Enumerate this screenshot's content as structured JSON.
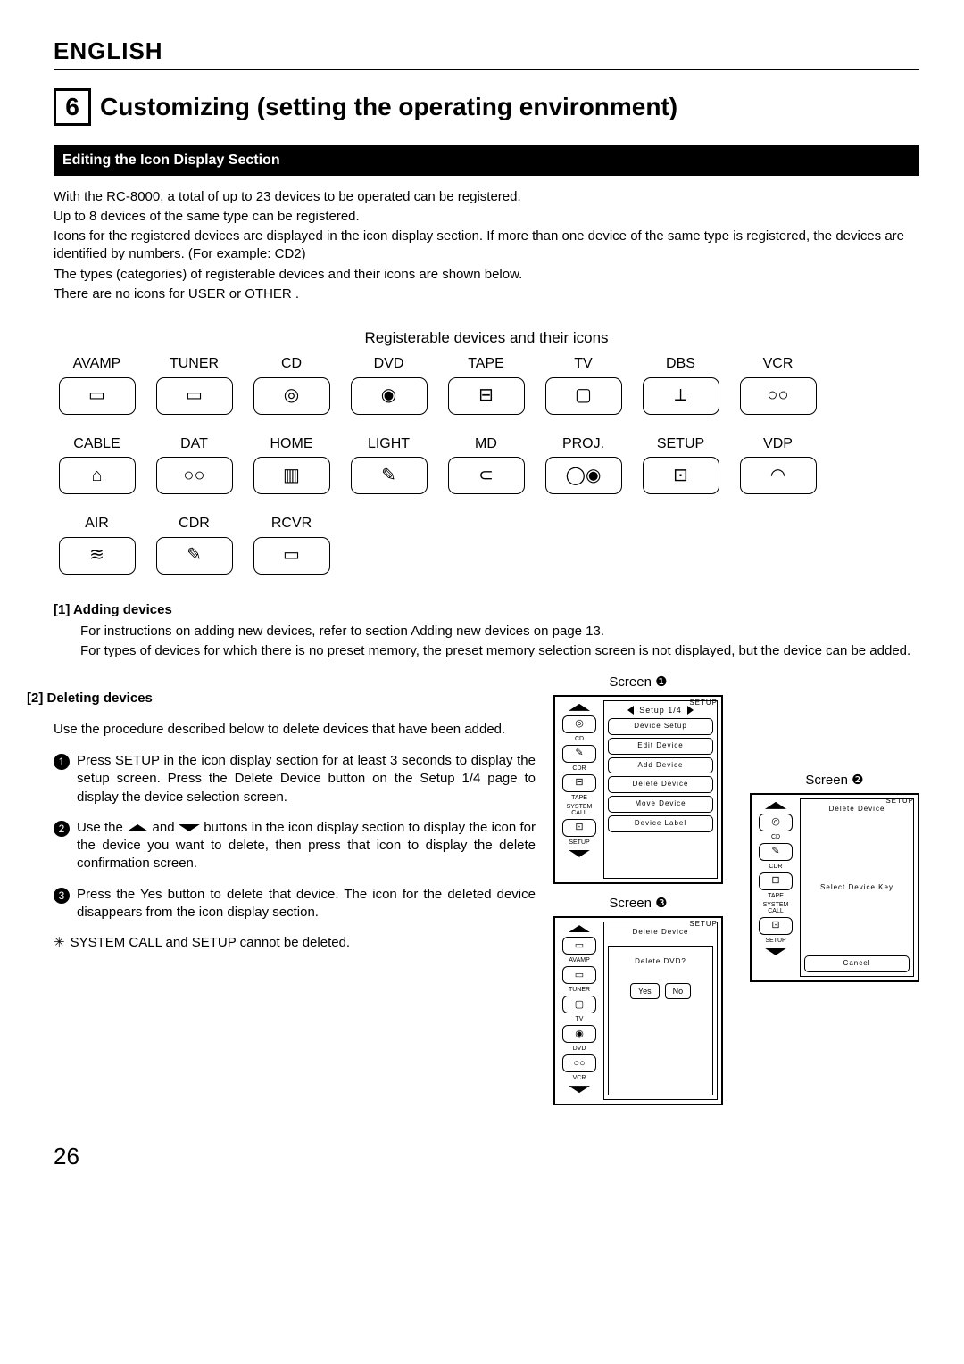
{
  "lang": "ENGLISH",
  "section_number": "6",
  "section_title": "Customizing (setting the operating environment)",
  "black_bar": "Editing the Icon Display Section",
  "intro": [
    "With the RC-8000, a total of up to 23 devices to be operated can be registered.",
    "Up to 8 devices of the same type can be registered.",
    "Icons for the registered devices are displayed in the icon display section.  If more than one device of the same type is registered, the devices are identified by numbers.  (For example:  CD2)",
    "The types (categories) of registerable devices and their icons are shown below.",
    "There are no icons for  USER  or  OTHER ."
  ],
  "icons_caption": "Registerable devices and their icons",
  "icons": [
    {
      "label": "AVAMP",
      "glyph": "▭"
    },
    {
      "label": "TUNER",
      "glyph": "▭"
    },
    {
      "label": "CD",
      "glyph": "◎"
    },
    {
      "label": "DVD",
      "glyph": "◉"
    },
    {
      "label": "TAPE",
      "glyph": "⊟"
    },
    {
      "label": "TV",
      "glyph": "▢"
    },
    {
      "label": "DBS",
      "glyph": "⟂"
    },
    {
      "label": "VCR",
      "glyph": "○○"
    },
    {
      "label": "CABLE",
      "glyph": "⌂"
    },
    {
      "label": "DAT",
      "glyph": "○○"
    },
    {
      "label": "HOME",
      "glyph": "▥"
    },
    {
      "label": "LIGHT",
      "glyph": "✎"
    },
    {
      "label": "MD",
      "glyph": "⊂"
    },
    {
      "label": "PROJ.",
      "glyph": "◯◉"
    },
    {
      "label": "SETUP",
      "glyph": "⊡"
    },
    {
      "label": "VDP",
      "glyph": "◠"
    },
    {
      "label": "AIR",
      "glyph": "≋"
    },
    {
      "label": "CDR",
      "glyph": "✎"
    },
    {
      "label": "RCVR",
      "glyph": "▭"
    }
  ],
  "sub1_head": "[1]  Adding devices",
  "sub1_body": [
    "For instructions on adding new devices, refer to section  Adding new devices  on page 13.",
    "For types of devices for which there is no preset memory, the preset memory selection screen is not displayed, but the device can be added."
  ],
  "sub2_head": "[2]  Deleting devices",
  "sub2_intro": "Use the procedure described below to delete devices that have been added.",
  "steps": [
    {
      "n": "1",
      "text": "Press  SETUP  in the icon display section for at least 3 seconds to display the setup screen. Press the  Delete Device  button on the  Setup 1/4  page to display the device selection screen."
    },
    {
      "n": "2",
      "text_parts": [
        "Use the ",
        " and ",
        " buttons in the icon display section to display the icon for the device you want to delete, then press that icon to display the delete confirmation screen."
      ]
    },
    {
      "n": "3",
      "text": "Press the  Yes  button to delete that device. The icon for the deleted device disappears from the icon display section."
    }
  ],
  "note_mark": "✳",
  "note_text": " SYSTEM CALL  and  SETUP  cannot be deleted.",
  "screen1": {
    "label": "Screen ❶",
    "tag": "SETUP",
    "side": [
      {
        "lbl": "CD",
        "g": "◎"
      },
      {
        "lbl": "CDR",
        "g": "✎"
      },
      {
        "lbl": "TAPE",
        "g": "⊟"
      },
      {
        "slbl": "SYSTEM CALL"
      },
      {
        "lbl": "SETUP",
        "g": "⊡"
      }
    ],
    "header": "Setup 1/4",
    "buttons": [
      "Device Setup",
      "Edit Device",
      "Add Device",
      "Delete Device",
      "Move Device",
      "Device Label"
    ]
  },
  "screen2": {
    "label": "Screen ❷",
    "tag": "SETUP",
    "side": [
      {
        "lbl": "CD",
        "g": "◎"
      },
      {
        "lbl": "CDR",
        "g": "✎"
      },
      {
        "lbl": "TAPE",
        "g": "⊟"
      },
      {
        "slbl": "SYSTEM CALL"
      },
      {
        "lbl": "SETUP",
        "g": "⊡"
      }
    ],
    "title": "Delete Device",
    "subtitle": "Select Device Key",
    "cancel": "Cancel"
  },
  "screen3": {
    "label": "Screen ❸",
    "tag": "SETUP",
    "side": [
      {
        "lbl": "AVAMP",
        "g": "▭"
      },
      {
        "lbl": "TUNER",
        "g": "▭"
      },
      {
        "lbl": "TV",
        "g": "▢"
      },
      {
        "lbl": "DVD",
        "g": "◉"
      },
      {
        "lbl": "VCR",
        "g": "○○"
      }
    ],
    "title": "Delete Device",
    "question": "Delete DVD?",
    "yes": "Yes",
    "no": "No"
  },
  "page_number": "26"
}
